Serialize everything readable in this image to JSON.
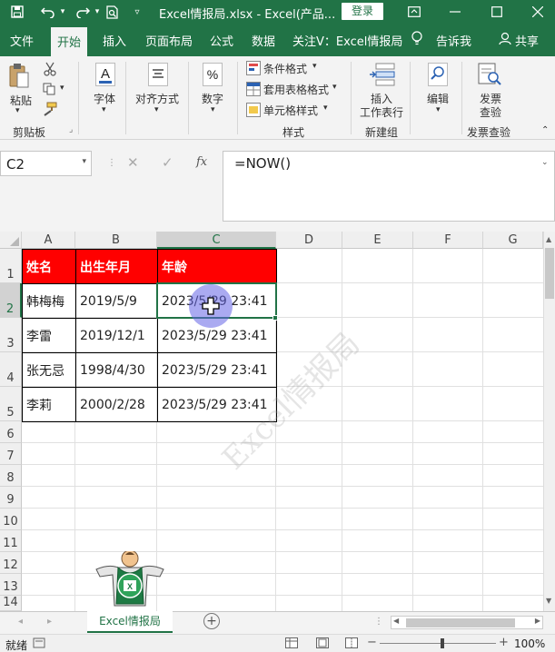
{
  "window": {
    "title": "Excel情报局.xlsx  -  Excel(产品...",
    "login_label": "登录",
    "caption_restore_icon": "restore-icon"
  },
  "ribbon_tabs": [
    {
      "label": "文件",
      "active": false
    },
    {
      "label": "开始",
      "active": true
    },
    {
      "label": "插入",
      "active": false
    },
    {
      "label": "页面布局",
      "active": false
    },
    {
      "label": "公式",
      "active": false
    },
    {
      "label": "数据",
      "active": false
    },
    {
      "label": "关注V：Excel情报局",
      "active": false
    },
    {
      "label": "告诉我",
      "active": false
    },
    {
      "label": "共享",
      "active": false
    }
  ],
  "ribbon": {
    "paste": "粘贴",
    "clipboard_group": "剪贴板",
    "font": "字体",
    "alignment": "对齐方式",
    "number": "数字",
    "conditional_format": "条件格式",
    "table_format": "套用表格格式",
    "cell_style": "单元格样式",
    "styles_group": "样式",
    "insert_row": "插入",
    "insert_row_2": "工作表行",
    "newgroup_group": "新建组",
    "edit": "编辑",
    "invoice_check_1": "发票",
    "invoice_check_2": "查验",
    "invoice_group": "发票查验"
  },
  "formula_bar": {
    "name_box": "C2",
    "formula": "=NOW()"
  },
  "columns": [
    "A",
    "B",
    "C",
    "D",
    "E",
    "F",
    "G"
  ],
  "rows": [
    "1",
    "2",
    "3",
    "4",
    "5",
    "6",
    "7",
    "8",
    "9",
    "10",
    "11",
    "12",
    "13",
    "14"
  ],
  "table": {
    "headers": [
      "姓名",
      "出生年月",
      "年龄"
    ],
    "rows": [
      [
        "韩梅梅",
        "2019/5/9",
        "2023/5/29 23:41"
      ],
      [
        "李雷",
        "2019/12/1",
        "2023/5/29 23:41"
      ],
      [
        "张无忌",
        "1998/4/30",
        "2023/5/29 23:41"
      ],
      [
        "李莉",
        "2000/2/28",
        "2023/5/29 23:41"
      ]
    ]
  },
  "watermark": "Excel情报局",
  "sheet_tab": "Excel情报局",
  "status": {
    "ready": "就绪",
    "zoom": "100%"
  },
  "colors": {
    "excel_green": "#217346",
    "header_red": "#ff0000",
    "selection": "#217346"
  }
}
